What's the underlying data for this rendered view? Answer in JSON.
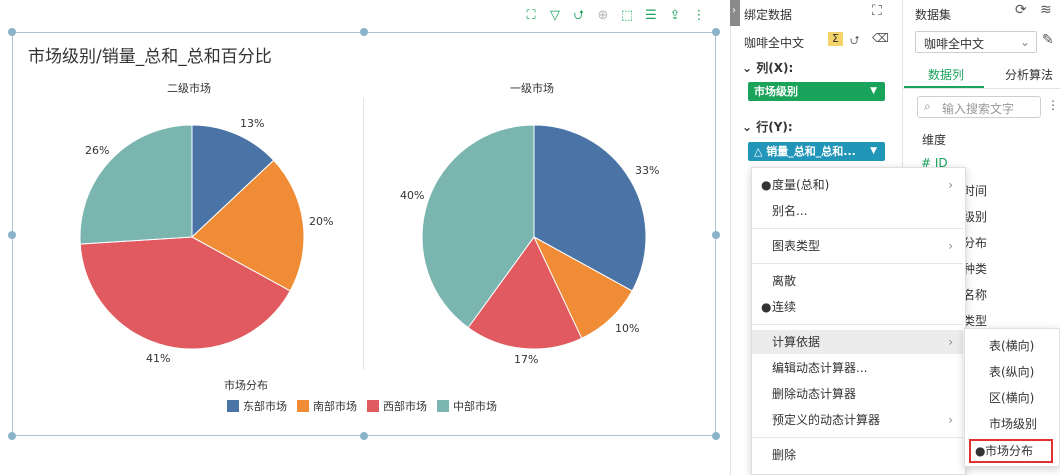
{
  "chart": {
    "title": "市场级别/销量_总和_总和百分比",
    "pies": [
      {
        "label": "二级市场",
        "slices": [
          {
            "name": "东部市场",
            "value": 13,
            "label": "13%"
          },
          {
            "name": "南部市场",
            "value": 20,
            "label": "20%"
          },
          {
            "name": "西部市场",
            "value": 41,
            "label": "41%"
          },
          {
            "name": "中部市场",
            "value": 26,
            "label": "26%"
          }
        ]
      },
      {
        "label": "一级市场",
        "slices": [
          {
            "name": "东部市场",
            "value": 33,
            "label": "33%"
          },
          {
            "name": "南部市场",
            "value": 10,
            "label": "10%"
          },
          {
            "name": "西部市场",
            "value": 17,
            "label": "17%"
          },
          {
            "name": "中部市场",
            "value": 40,
            "label": "40%"
          }
        ]
      }
    ],
    "legend_title": "市场分布",
    "legend": [
      {
        "name": "东部市场",
        "color": "#4a74a5"
      },
      {
        "name": "南部市场",
        "color": "#f08c35"
      },
      {
        "name": "西部市场",
        "color": "#e05a5f"
      },
      {
        "name": "中部市场",
        "color": "#7ab5b0"
      }
    ]
  },
  "chart_data": [
    {
      "type": "pie",
      "title": "二级市场",
      "categories": [
        "东部市场",
        "南部市场",
        "西部市场",
        "中部市场"
      ],
      "values": [
        13,
        20,
        41,
        26
      ]
    },
    {
      "type": "pie",
      "title": "一级市场",
      "categories": [
        "东部市场",
        "南部市场",
        "西部市场",
        "中部市场"
      ],
      "values": [
        33,
        10,
        17,
        40
      ]
    }
  ],
  "bind_panel": {
    "title": "绑定数据",
    "source": "咖啡全中文",
    "col_label": "列(X):",
    "col_field": "市场级别",
    "row_label": "行(Y):",
    "row_field": "销量_总和_总和..."
  },
  "data_panel": {
    "title": "数据集",
    "dataset": "咖啡全中文",
    "tab_columns": "数据列",
    "tab_analysis": "分析算法",
    "search_placeholder": "输入搜索文字",
    "dimension_label": "维度",
    "fields": [
      "ID",
      "时间",
      "级别",
      "分布",
      "种类",
      "名称",
      "类型"
    ]
  },
  "context_menu": {
    "items": [
      "度量(总和)",
      "别名...",
      "图表类型",
      "离散",
      "连续",
      "计算依据",
      "编辑动态计算器...",
      "删除动态计算器",
      "预定义的动态计算器",
      "删除"
    ]
  },
  "submenu": {
    "items": [
      "表(横向)",
      "表(纵向)",
      "区(横向)",
      "市场级别",
      "市场分布"
    ]
  },
  "colors": {
    "accent": "#1aa35a",
    "row_pill": "#2196b8",
    "highlight": "#e03131"
  }
}
